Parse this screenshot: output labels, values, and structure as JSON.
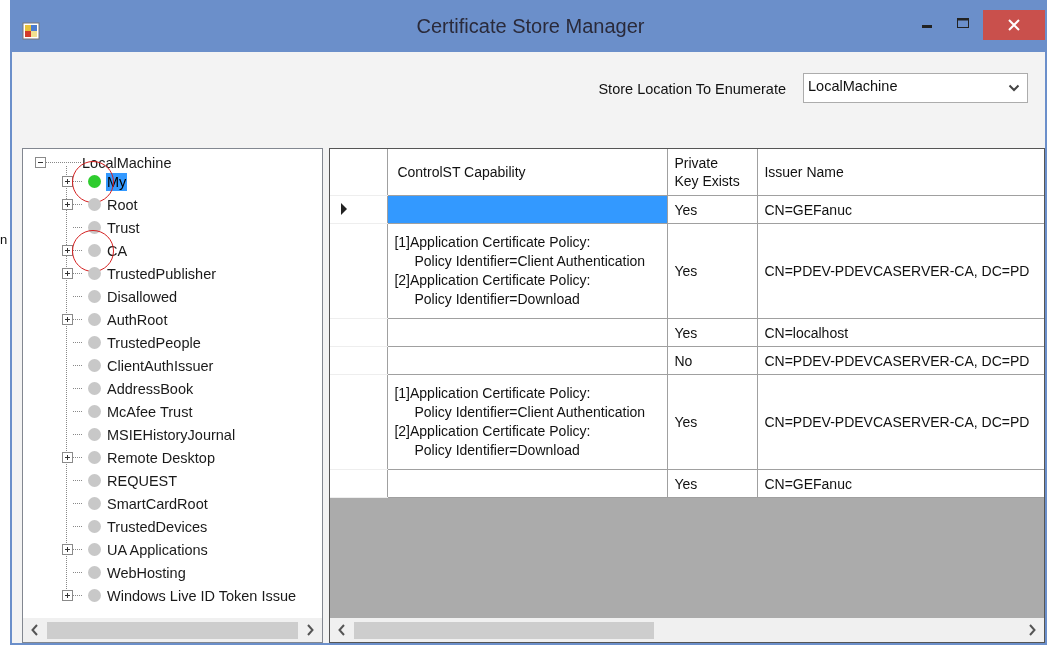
{
  "margin_text": "n",
  "window": {
    "title": "Certificate Store Manager"
  },
  "store_location": {
    "label": "Store Location To Enumerate",
    "value": "LocalMachine"
  },
  "tree": {
    "label": "LocalMachine",
    "expanded": true,
    "children": [
      {
        "label": "My",
        "expandable": true,
        "selected": true,
        "color": "#2ecc2e",
        "annotated": true
      },
      {
        "label": "Root",
        "expandable": true,
        "selected": false,
        "color": "#c8c8c8",
        "annotated": false
      },
      {
        "label": "Trust",
        "expandable": false,
        "selected": false,
        "color": "#c8c8c8",
        "annotated": false
      },
      {
        "label": "CA",
        "expandable": true,
        "selected": false,
        "color": "#c8c8c8",
        "annotated": true
      },
      {
        "label": "TrustedPublisher",
        "expandable": true,
        "selected": false,
        "color": "#c8c8c8",
        "annotated": false
      },
      {
        "label": "Disallowed",
        "expandable": false,
        "selected": false,
        "color": "#c8c8c8",
        "annotated": false
      },
      {
        "label": "AuthRoot",
        "expandable": true,
        "selected": false,
        "color": "#c8c8c8",
        "annotated": false
      },
      {
        "label": "TrustedPeople",
        "expandable": false,
        "selected": false,
        "color": "#c8c8c8",
        "annotated": false
      },
      {
        "label": "ClientAuthIssuer",
        "expandable": false,
        "selected": false,
        "color": "#c8c8c8",
        "annotated": false
      },
      {
        "label": "AddressBook",
        "expandable": false,
        "selected": false,
        "color": "#c8c8c8",
        "annotated": false
      },
      {
        "label": "McAfee Trust",
        "expandable": false,
        "selected": false,
        "color": "#c8c8c8",
        "annotated": false
      },
      {
        "label": "MSIEHistoryJournal",
        "expandable": false,
        "selected": false,
        "color": "#c8c8c8",
        "annotated": false
      },
      {
        "label": "Remote Desktop",
        "expandable": true,
        "selected": false,
        "color": "#c8c8c8",
        "annotated": false
      },
      {
        "label": "REQUEST",
        "expandable": false,
        "selected": false,
        "color": "#c8c8c8",
        "annotated": false
      },
      {
        "label": "SmartCardRoot",
        "expandable": false,
        "selected": false,
        "color": "#c8c8c8",
        "annotated": false
      },
      {
        "label": "TrustedDevices",
        "expandable": false,
        "selected": false,
        "color": "#c8c8c8",
        "annotated": false
      },
      {
        "label": "UA Applications",
        "expandable": true,
        "selected": false,
        "color": "#c8c8c8",
        "annotated": false
      },
      {
        "label": "WebHosting",
        "expandable": false,
        "selected": false,
        "color": "#c8c8c8",
        "annotated": false
      },
      {
        "label": "Windows Live ID Token Issue",
        "expandable": true,
        "selected": false,
        "color": "#c8c8c8",
        "annotated": false
      }
    ]
  },
  "table": {
    "columns": [
      "ControlST Capability",
      "Private\nKey Exists",
      "Issuer Name"
    ],
    "rows": [
      {
        "current": true,
        "selected": true,
        "capability": [],
        "private_key": "Yes",
        "issuer": "CN=GEFanuc"
      },
      {
        "current": false,
        "selected": false,
        "capability": [
          {
            "text": "[1]Application Certificate Policy:",
            "indent": false
          },
          {
            "text": "Policy Identifier=Client Authentication",
            "indent": true
          },
          {
            "text": "[2]Application Certificate Policy:",
            "indent": false
          },
          {
            "text": "Policy Identifier=Download",
            "indent": true
          }
        ],
        "private_key": "Yes",
        "issuer": "CN=PDEV-PDEVCASERVER-CA, DC=PD"
      },
      {
        "current": false,
        "selected": false,
        "capability": [],
        "private_key": "Yes",
        "issuer": "CN=localhost"
      },
      {
        "current": false,
        "selected": false,
        "capability": [],
        "private_key": "No",
        "issuer": "CN=PDEV-PDEVCASERVER-CA, DC=PD"
      },
      {
        "current": false,
        "selected": false,
        "capability": [
          {
            "text": "[1]Application Certificate Policy:",
            "indent": false
          },
          {
            "text": "Policy Identifier=Client Authentication",
            "indent": true
          },
          {
            "text": "[2]Application Certificate Policy:",
            "indent": false
          },
          {
            "text": "Policy Identifier=Download",
            "indent": true
          }
        ],
        "private_key": "Yes",
        "issuer": "CN=PDEV-PDEVCASERVER-CA, DC=PD"
      },
      {
        "current": false,
        "selected": false,
        "capability": [],
        "private_key": "Yes",
        "issuer": "CN=GEFanuc"
      }
    ]
  }
}
